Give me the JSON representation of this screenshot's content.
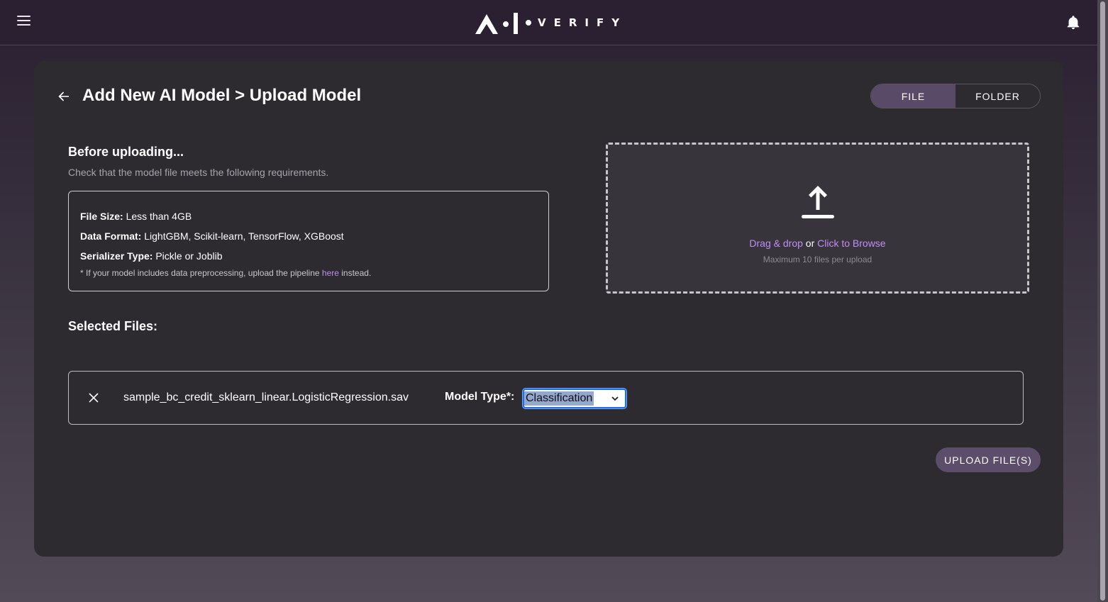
{
  "header": {
    "logo_text": "VERIFY"
  },
  "page": {
    "title": "Add New AI Model > Upload Model"
  },
  "upload_toggle": {
    "options": [
      "FILE",
      "FOLDER"
    ],
    "selected": "FILE"
  },
  "requirements": {
    "title": "Before uploading...",
    "subtitle": "Check that the model file meets the following requirements.",
    "items": [
      {
        "label": "File Size:",
        "value": "Less than 4GB"
      },
      {
        "label": "Data Format:",
        "value": "LightGBM, Scikit-learn, TensorFlow, XGBoost"
      },
      {
        "label": "Serializer Type:",
        "value": "Pickle or Joblib"
      }
    ],
    "note_prefix": "* If your model includes data preprocessing, upload the pipeline ",
    "note_link": "here",
    "note_suffix": " instead."
  },
  "dropzone": {
    "drag_text": "Drag & drop",
    "or_text": " or ",
    "browse_text": "Click to Browse",
    "hint": "Maximum 10 files per upload"
  },
  "selected_files": {
    "title": "Selected Files:",
    "files": [
      {
        "name": "sample_bc_credit_sklearn_linear.LogisticRegression.sav",
        "model_type_label": "Model Type*:",
        "model_type_value": "Classification"
      }
    ]
  },
  "actions": {
    "upload_label": "UPLOAD FILE(S)"
  },
  "colors": {
    "accent_link": "#c08df4",
    "active_toggle": "#594a67",
    "upload_button": "#5c4d6a",
    "card_bg": "#2d2a30"
  },
  "icons": [
    "menu-icon",
    "logo-icon",
    "bell-icon",
    "back-arrow-icon",
    "upload-icon",
    "close-icon",
    "chevron-down-icon"
  ]
}
